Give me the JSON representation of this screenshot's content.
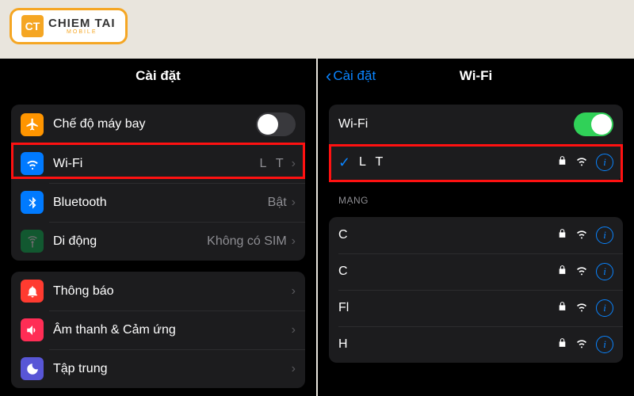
{
  "logo": {
    "badge": "CT",
    "main": "CHIEM TAI",
    "sub": "MOBILE"
  },
  "left": {
    "title": "Cài đặt",
    "group1": {
      "airplane": "Chế độ máy bay",
      "wifi": {
        "label": "Wi-Fi",
        "value": "L      T"
      },
      "bluetooth": {
        "label": "Bluetooth",
        "value": "Bật"
      },
      "mobile": {
        "label": "Di động",
        "value": "Không có SIM"
      }
    },
    "group2": {
      "notif": "Thông báo",
      "sound": "Âm thanh & Cảm ứng",
      "focus": "Tập trung"
    }
  },
  "right": {
    "back": "Cài đặt",
    "title": "Wi-Fi",
    "toggle_label": "Wi-Fi",
    "connected": "L      T",
    "section": "MẠNG",
    "networks": [
      "C",
      "C",
      "Fl",
      "H"
    ]
  }
}
